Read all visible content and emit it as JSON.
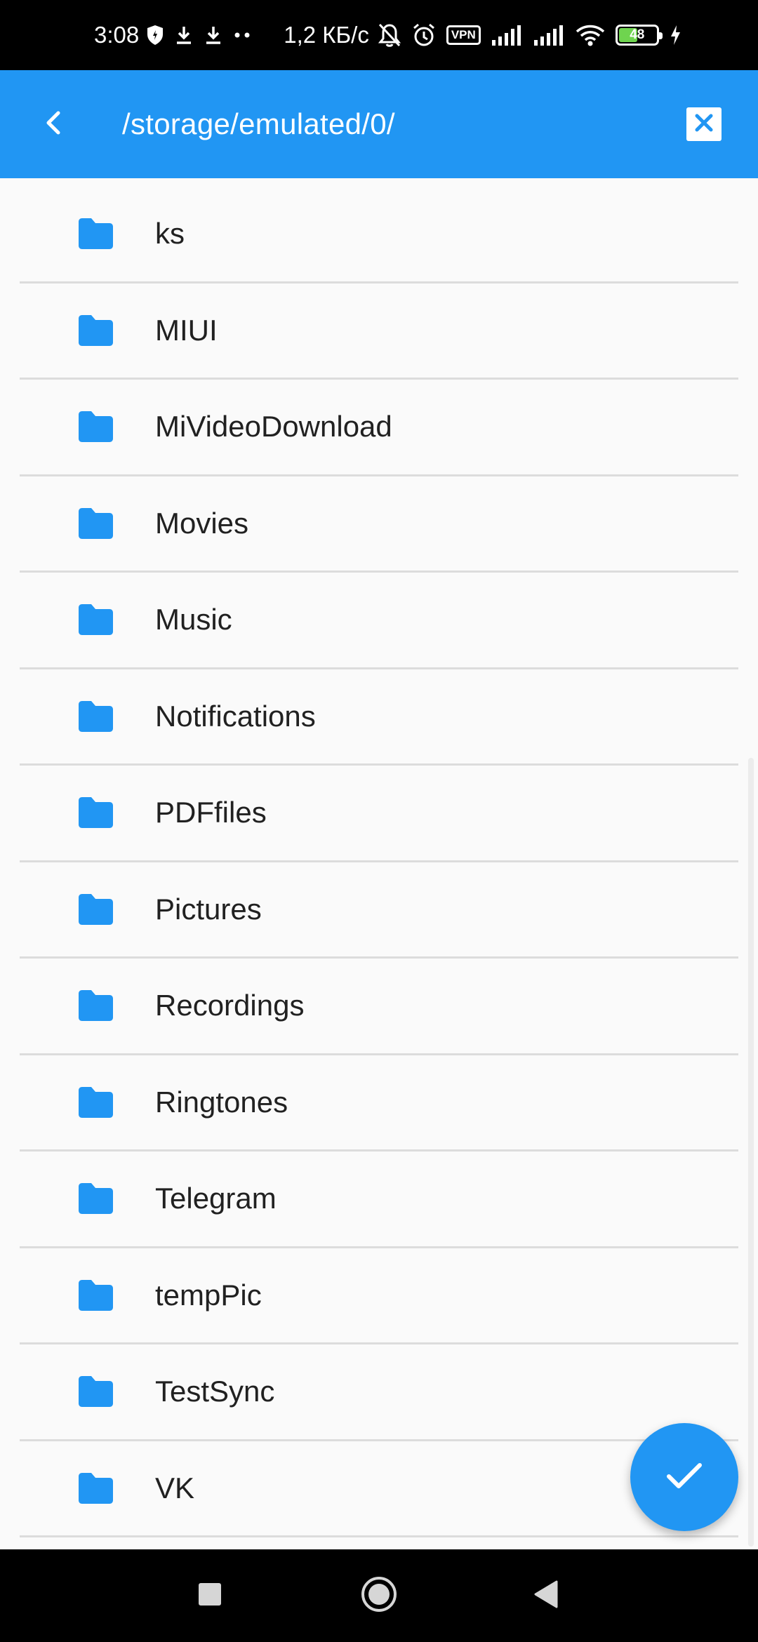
{
  "status_bar": {
    "time": "3:08",
    "network_speed": "1,2 КБ/с",
    "vpn_label": "VPN",
    "battery_level": "48"
  },
  "app_bar": {
    "path": "/storage/emulated/0/"
  },
  "folders": [
    {
      "name": "ks"
    },
    {
      "name": "MIUI"
    },
    {
      "name": "MiVideoDownload"
    },
    {
      "name": "Movies"
    },
    {
      "name": "Music"
    },
    {
      "name": "Notifications"
    },
    {
      "name": "PDFfiles"
    },
    {
      "name": "Pictures"
    },
    {
      "name": "Recordings"
    },
    {
      "name": "Ringtones"
    },
    {
      "name": "Telegram"
    },
    {
      "name": "tempPic"
    },
    {
      "name": "TestSync"
    },
    {
      "name": "VK"
    }
  ],
  "colors": {
    "primary": "#2196f3",
    "folder_icon": "#2196f3",
    "background": "#fafafa",
    "divider": "#dcdcdc"
  },
  "icons": {
    "back": "chevron-left-icon",
    "close": "close-icon",
    "folder": "folder-icon",
    "confirm": "check-icon"
  }
}
